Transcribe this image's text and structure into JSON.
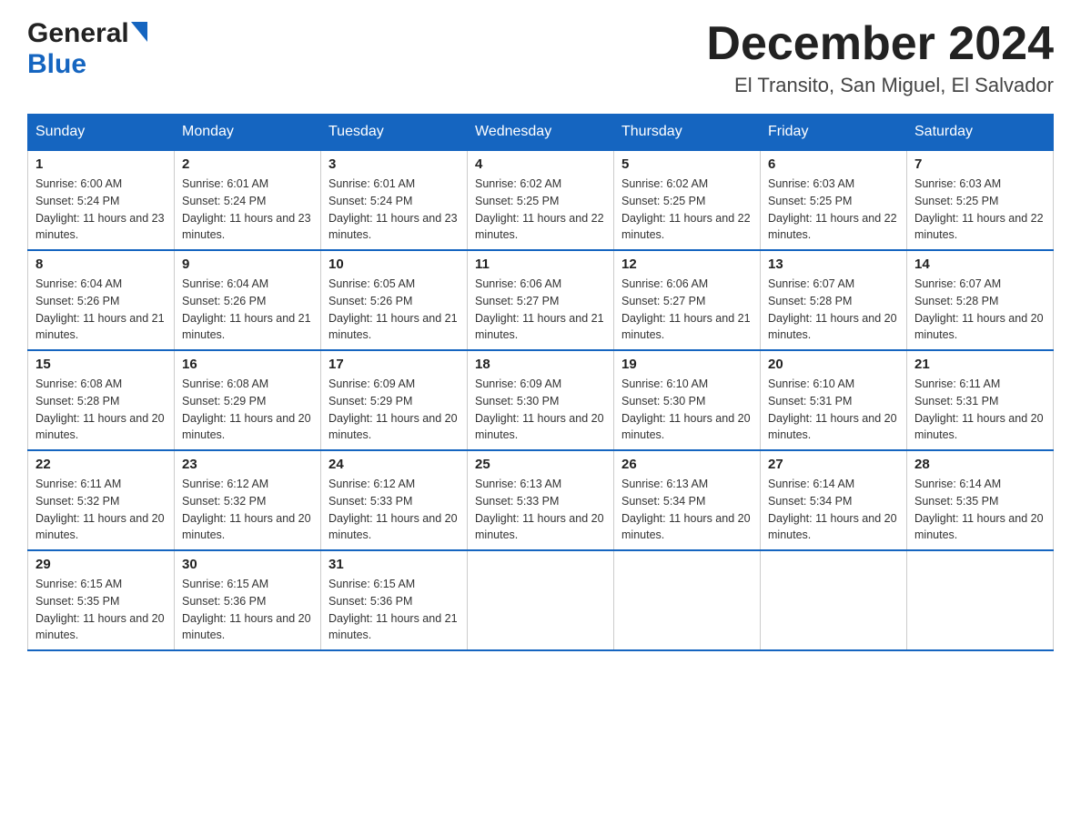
{
  "header": {
    "logo_general": "General",
    "logo_blue": "Blue",
    "main_title": "December 2024",
    "subtitle": "El Transito, San Miguel, El Salvador"
  },
  "days_of_week": [
    "Sunday",
    "Monday",
    "Tuesday",
    "Wednesday",
    "Thursday",
    "Friday",
    "Saturday"
  ],
  "weeks": [
    [
      {
        "day": "1",
        "sunrise": "6:00 AM",
        "sunset": "5:24 PM",
        "daylight": "11 hours and 23 minutes."
      },
      {
        "day": "2",
        "sunrise": "6:01 AM",
        "sunset": "5:24 PM",
        "daylight": "11 hours and 23 minutes."
      },
      {
        "day": "3",
        "sunrise": "6:01 AM",
        "sunset": "5:24 PM",
        "daylight": "11 hours and 23 minutes."
      },
      {
        "day": "4",
        "sunrise": "6:02 AM",
        "sunset": "5:25 PM",
        "daylight": "11 hours and 22 minutes."
      },
      {
        "day": "5",
        "sunrise": "6:02 AM",
        "sunset": "5:25 PM",
        "daylight": "11 hours and 22 minutes."
      },
      {
        "day": "6",
        "sunrise": "6:03 AM",
        "sunset": "5:25 PM",
        "daylight": "11 hours and 22 minutes."
      },
      {
        "day": "7",
        "sunrise": "6:03 AM",
        "sunset": "5:25 PM",
        "daylight": "11 hours and 22 minutes."
      }
    ],
    [
      {
        "day": "8",
        "sunrise": "6:04 AM",
        "sunset": "5:26 PM",
        "daylight": "11 hours and 21 minutes."
      },
      {
        "day": "9",
        "sunrise": "6:04 AM",
        "sunset": "5:26 PM",
        "daylight": "11 hours and 21 minutes."
      },
      {
        "day": "10",
        "sunrise": "6:05 AM",
        "sunset": "5:26 PM",
        "daylight": "11 hours and 21 minutes."
      },
      {
        "day": "11",
        "sunrise": "6:06 AM",
        "sunset": "5:27 PM",
        "daylight": "11 hours and 21 minutes."
      },
      {
        "day": "12",
        "sunrise": "6:06 AM",
        "sunset": "5:27 PM",
        "daylight": "11 hours and 21 minutes."
      },
      {
        "day": "13",
        "sunrise": "6:07 AM",
        "sunset": "5:28 PM",
        "daylight": "11 hours and 20 minutes."
      },
      {
        "day": "14",
        "sunrise": "6:07 AM",
        "sunset": "5:28 PM",
        "daylight": "11 hours and 20 minutes."
      }
    ],
    [
      {
        "day": "15",
        "sunrise": "6:08 AM",
        "sunset": "5:28 PM",
        "daylight": "11 hours and 20 minutes."
      },
      {
        "day": "16",
        "sunrise": "6:08 AM",
        "sunset": "5:29 PM",
        "daylight": "11 hours and 20 minutes."
      },
      {
        "day": "17",
        "sunrise": "6:09 AM",
        "sunset": "5:29 PM",
        "daylight": "11 hours and 20 minutes."
      },
      {
        "day": "18",
        "sunrise": "6:09 AM",
        "sunset": "5:30 PM",
        "daylight": "11 hours and 20 minutes."
      },
      {
        "day": "19",
        "sunrise": "6:10 AM",
        "sunset": "5:30 PM",
        "daylight": "11 hours and 20 minutes."
      },
      {
        "day": "20",
        "sunrise": "6:10 AM",
        "sunset": "5:31 PM",
        "daylight": "11 hours and 20 minutes."
      },
      {
        "day": "21",
        "sunrise": "6:11 AM",
        "sunset": "5:31 PM",
        "daylight": "11 hours and 20 minutes."
      }
    ],
    [
      {
        "day": "22",
        "sunrise": "6:11 AM",
        "sunset": "5:32 PM",
        "daylight": "11 hours and 20 minutes."
      },
      {
        "day": "23",
        "sunrise": "6:12 AM",
        "sunset": "5:32 PM",
        "daylight": "11 hours and 20 minutes."
      },
      {
        "day": "24",
        "sunrise": "6:12 AM",
        "sunset": "5:33 PM",
        "daylight": "11 hours and 20 minutes."
      },
      {
        "day": "25",
        "sunrise": "6:13 AM",
        "sunset": "5:33 PM",
        "daylight": "11 hours and 20 minutes."
      },
      {
        "day": "26",
        "sunrise": "6:13 AM",
        "sunset": "5:34 PM",
        "daylight": "11 hours and 20 minutes."
      },
      {
        "day": "27",
        "sunrise": "6:14 AM",
        "sunset": "5:34 PM",
        "daylight": "11 hours and 20 minutes."
      },
      {
        "day": "28",
        "sunrise": "6:14 AM",
        "sunset": "5:35 PM",
        "daylight": "11 hours and 20 minutes."
      }
    ],
    [
      {
        "day": "29",
        "sunrise": "6:15 AM",
        "sunset": "5:35 PM",
        "daylight": "11 hours and 20 minutes."
      },
      {
        "day": "30",
        "sunrise": "6:15 AM",
        "sunset": "5:36 PM",
        "daylight": "11 hours and 20 minutes."
      },
      {
        "day": "31",
        "sunrise": "6:15 AM",
        "sunset": "5:36 PM",
        "daylight": "11 hours and 21 minutes."
      },
      null,
      null,
      null,
      null
    ]
  ],
  "labels": {
    "sunrise": "Sunrise:",
    "sunset": "Sunset:",
    "daylight": "Daylight:"
  }
}
